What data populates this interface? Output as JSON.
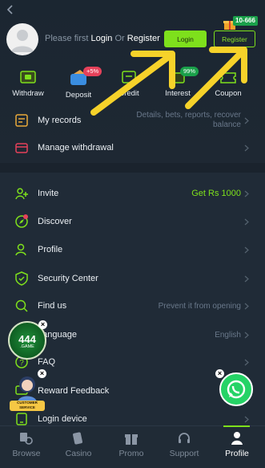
{
  "header": {
    "login_prompt_part1": "Please first",
    "login_word": "Login",
    "or_word": "Or",
    "register_word": "Register",
    "login_button": "Login",
    "register_button": "Register",
    "register_badge": "10-666"
  },
  "quick_actions": [
    {
      "label": "Withdraw",
      "icon": "withdraw-icon"
    },
    {
      "label": "Deposit",
      "icon": "deposit-icon",
      "badge": "+5%"
    },
    {
      "label": "Credit",
      "icon": "credit-icon"
    },
    {
      "label": "Interest",
      "icon": "interest-icon",
      "badge": "99%"
    },
    {
      "label": "Coupon",
      "icon": "coupon-icon"
    }
  ],
  "records": {
    "my_records": "My records",
    "my_records_hint": "Details, bets, reports, recover balance",
    "manage_withdrawal": "Manage withdrawal"
  },
  "menu": {
    "invite": "Invite",
    "invite_hint": "Get Rs 1000",
    "discover": "Discover",
    "profile": "Profile",
    "security_center": "Security Center",
    "find_us": "Find us",
    "find_us_hint": "Prevent it from opening",
    "language": "Language",
    "language_value": "English",
    "faq": "FAQ",
    "reward_feedback": "Reward Feedback",
    "login_device": "Login device"
  },
  "floating": {
    "logo_text": "444",
    "logo_sub": ".GAME",
    "cs_label_1": "CUSTOMER",
    "cs_label_2": "SERVICE"
  },
  "nav": {
    "browse": "Browse",
    "casino": "Casino",
    "promo": "Promo",
    "support": "Support",
    "profile": "Profile"
  },
  "colors": {
    "accent_green": "#7ee01c",
    "badge_red": "#e5415a",
    "arrow_yellow": "#f6d22a"
  }
}
